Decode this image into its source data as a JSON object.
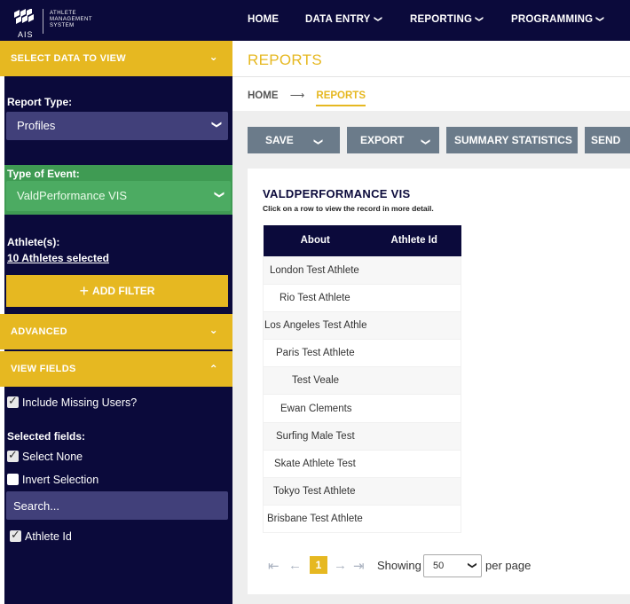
{
  "brand": {
    "mark": "AIS",
    "lines": [
      "ATHLETE",
      "MANAGEMENT",
      "SYSTEM"
    ]
  },
  "nav": {
    "home": "HOME",
    "data_entry": "DATA ENTRY",
    "reporting": "REPORTING",
    "programming": "PROGRAMMING"
  },
  "sidebar": {
    "select_data_header": "SELECT DATA TO VIEW",
    "report_type_label": "Report Type:",
    "report_type_value": "Profiles",
    "event_label": "Type of Event:",
    "event_value": "ValdPerformance VIS",
    "athletes_label": "Athlete(s):",
    "athletes_link": "10 Athletes selected",
    "add_filter": "ADD FILTER",
    "advanced_header": "ADVANCED",
    "view_fields_header": "VIEW FIELDS",
    "include_missing": "Include Missing Users?",
    "selected_fields_label": "Selected fields:",
    "select_none": "Select None",
    "invert_selection": "Invert Selection",
    "search_placeholder": "Search...",
    "field_athlete_id": "Athlete Id"
  },
  "main": {
    "title": "REPORTS",
    "breadcrumb_home": "HOME",
    "breadcrumb_current": "REPORTS",
    "toolbar": {
      "save": "SAVE",
      "export": "EXPORT",
      "summary": "SUMMARY STATISTICS",
      "send": "SEND"
    },
    "panel_title": "VALDPERFORMANCE VIS",
    "panel_subtitle": "Click on a row to view the record in more detail.",
    "table": {
      "headers": [
        "About",
        "Athlete Id"
      ],
      "rows": [
        "London Test Athlete",
        "Rio Test Athlete",
        "Los Angeles Test Athle",
        "Paris Test Athlete",
        "Test Veale",
        "Ewan Clements",
        "Surfing Male Test",
        "Skate Athlete Test",
        "Tokyo Test Athlete",
        "Brisbane Test Athlete"
      ]
    },
    "pager": {
      "current_page": "1",
      "showing": "Showing",
      "per_page_value": "50",
      "per_page": "per page"
    }
  },
  "colors": {
    "navy": "#0b0a3b",
    "gold": "#e6b821",
    "green": "#3f9b53",
    "toolbar_grey": "#6b7b8a"
  }
}
